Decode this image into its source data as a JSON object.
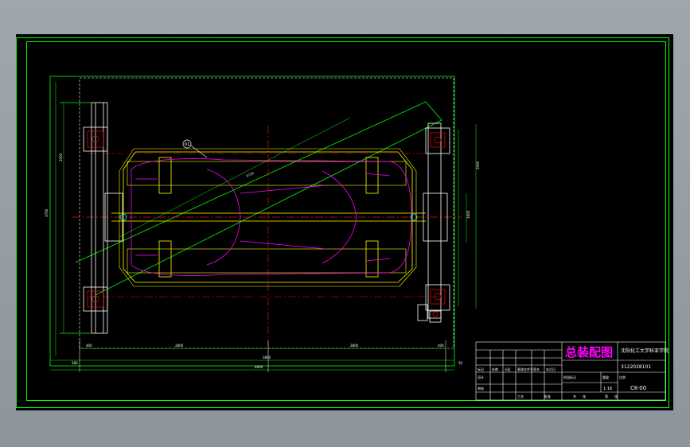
{
  "drawing": {
    "title": "总装配图",
    "school": "沈阳化工大学科亚学院",
    "drawing_no": "3122028101",
    "code": "CK-00",
    "scale": "1:16",
    "block_headers": [
      "标记",
      "处数",
      "分区",
      "更改文件号",
      "签名",
      "年月日"
    ],
    "block_labels": [
      "阶段标记",
      "重量",
      "比例"
    ],
    "block_roles": [
      "设计",
      "审核",
      "工艺",
      "批准"
    ],
    "block_misc": [
      "共",
      "张",
      "第",
      "张"
    ],
    "balloon": "01"
  },
  "dimensions": {
    "overall_width": "4600",
    "inner_width": "3800",
    "left_offset": "400",
    "right_offset": "400",
    "left_span": "2800",
    "right_span": "2800",
    "left_dim": "2000",
    "right_dim": "2000",
    "left_total": "3700",
    "right_total": "1600",
    "bottom_left": "580",
    "bottom_right": "50",
    "diag": "3720"
  },
  "colors": {
    "frame": "#00ff00",
    "lines": "#ffffff",
    "yellow": "#ffff00",
    "magenta": "#ff00ff",
    "red": "#ff0000",
    "green": "#00ff00",
    "cyan": "#00ffff"
  }
}
